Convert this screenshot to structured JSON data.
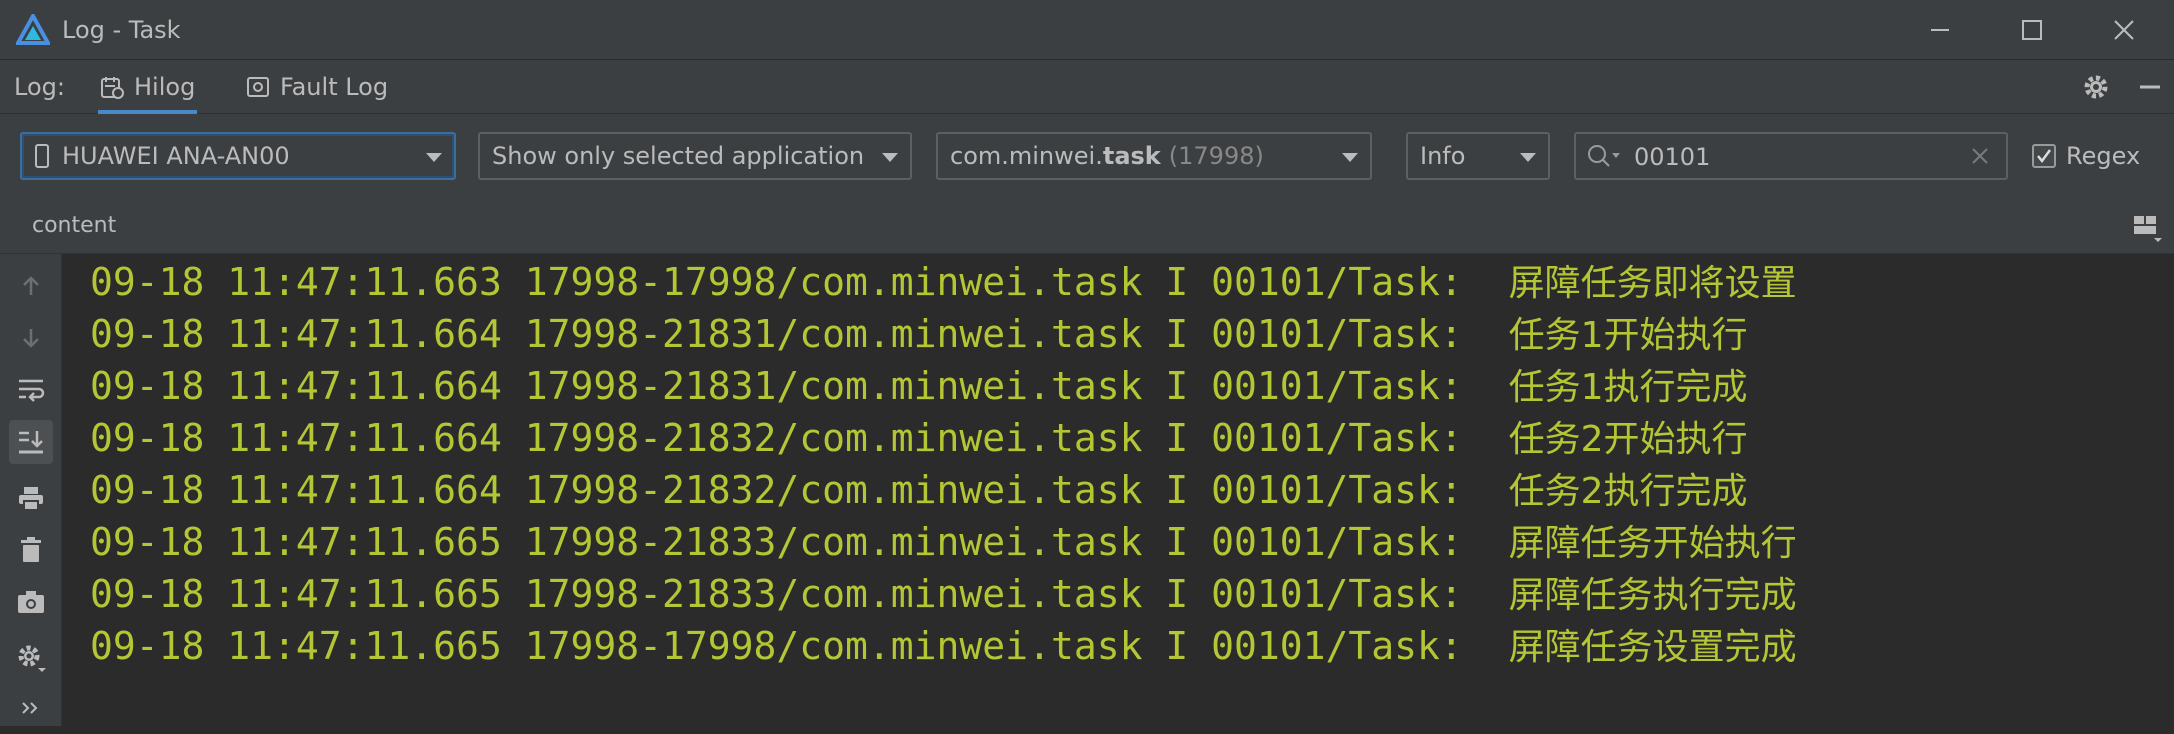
{
  "window": {
    "title": "Log - Task",
    "controls": [
      "minimize",
      "maximize",
      "close"
    ]
  },
  "tabs_bar": {
    "label": "Log:",
    "tabs": [
      {
        "label": "Hilog",
        "icon": "hilog-icon",
        "active": true
      },
      {
        "label": "Fault Log",
        "icon": "fault-log-icon",
        "active": false
      }
    ]
  },
  "filters": {
    "device": "HUAWEI ANA-AN00",
    "scope": "Show only selected application",
    "app_prefix": "com.minwei.",
    "app_name": "task",
    "app_pid": "(17998)",
    "level": "Info",
    "search_value": "00101",
    "regex_label": "Regex",
    "regex_checked": true
  },
  "column_header": {
    "label": "content"
  },
  "log_lines": [
    {
      "date": "09-18",
      "time": "11:47:11.663",
      "pid_tid": "17998-17998",
      "package": "com.minwei.task",
      "level": "I",
      "tag": "00101/Task:",
      "message": "屏障任务即将设置"
    },
    {
      "date": "09-18",
      "time": "11:47:11.664",
      "pid_tid": "17998-21831",
      "package": "com.minwei.task",
      "level": "I",
      "tag": "00101/Task:",
      "message": "任务1开始执行"
    },
    {
      "date": "09-18",
      "time": "11:47:11.664",
      "pid_tid": "17998-21831",
      "package": "com.minwei.task",
      "level": "I",
      "tag": "00101/Task:",
      "message": "任务1执行完成"
    },
    {
      "date": "09-18",
      "time": "11:47:11.664",
      "pid_tid": "17998-21832",
      "package": "com.minwei.task",
      "level": "I",
      "tag": "00101/Task:",
      "message": "任务2开始执行"
    },
    {
      "date": "09-18",
      "time": "11:47:11.664",
      "pid_tid": "17998-21832",
      "package": "com.minwei.task",
      "level": "I",
      "tag": "00101/Task:",
      "message": "任务2执行完成"
    },
    {
      "date": "09-18",
      "time": "11:47:11.665",
      "pid_tid": "17998-21833",
      "package": "com.minwei.task",
      "level": "I",
      "tag": "00101/Task:",
      "message": "屏障任务开始执行"
    },
    {
      "date": "09-18",
      "time": "11:47:11.665",
      "pid_tid": "17998-21833",
      "package": "com.minwei.task",
      "level": "I",
      "tag": "00101/Task:",
      "message": "屏障任务执行完成"
    },
    {
      "date": "09-18",
      "time": "11:47:11.665",
      "pid_tid": "17998-17998",
      "package": "com.minwei.task",
      "level": "I",
      "tag": "00101/Task:",
      "message": "屏障任务设置完成"
    }
  ],
  "sidebar_tools": [
    "scroll-up-icon",
    "scroll-down-icon",
    "soft-wrap-icon",
    "scroll-to-end-icon",
    "print-icon",
    "clear-log-icon",
    "screenshot-icon",
    "settings-icon",
    "more-icon"
  ],
  "colors": {
    "log_text": "#b5c635",
    "background": "#2b2b2b",
    "panel": "#3c3f41",
    "accent": "#4a88c7"
  }
}
